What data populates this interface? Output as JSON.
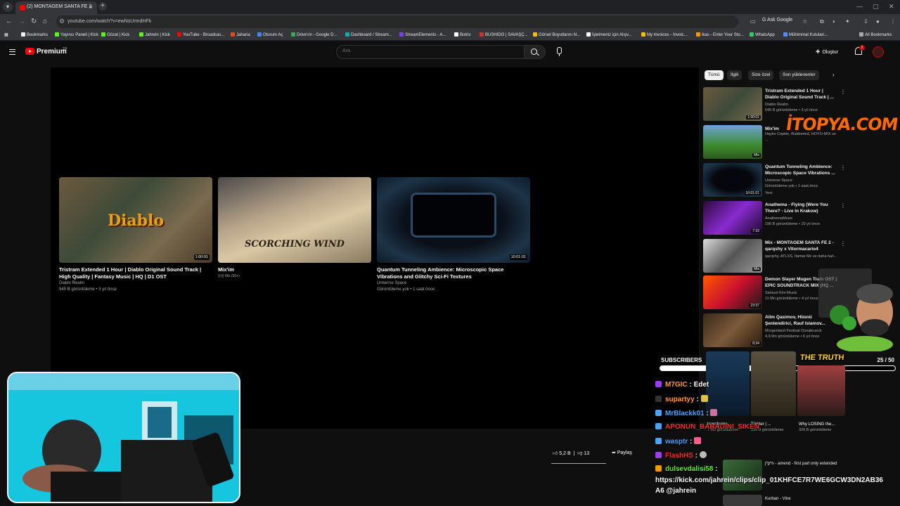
{
  "browser": {
    "tab_title": "(2) MONTAGEM SANTA FE 2",
    "url": "youtube.com/watch?v=ewNsUrmdHFk",
    "ask_google": "Ask Google",
    "all_bookmarks": "All Bookmarks",
    "bookmarks": [
      {
        "label": "Bookmarks",
        "color": "#f1f1f1"
      },
      {
        "label": "Yayıncı Paneli | Kick",
        "color": "#53fc18"
      },
      {
        "label": "Gözat | Kick",
        "color": "#53fc18"
      },
      {
        "label": "Jahrein | Kick",
        "color": "#53fc18"
      },
      {
        "label": "YouTube - Broadcas...",
        "color": "#ff0000"
      },
      {
        "label": "Jaharia",
        "color": "#e64a19"
      },
      {
        "label": "Oturum Aç",
        "color": "#4285f4"
      },
      {
        "label": "Drive'ım - Google D...",
        "color": "#34a853"
      },
      {
        "label": "Dashboard / Stream...",
        "color": "#00b2a9"
      },
      {
        "label": "StreamElements - A...",
        "color": "#7b3ff2"
      },
      {
        "label": "Botrix",
        "color": "#ffffff"
      },
      {
        "label": "BUSHIDO | SAVAŞÇ...",
        "color": "#d32f2f"
      },
      {
        "label": "Görsel Boyutlarını N...",
        "color": "#fbbc04"
      },
      {
        "label": "İşletmeniz için Alışv...",
        "color": "#ffffff"
      },
      {
        "label": "My Invoices - Invoic...",
        "color": "#fbbc04"
      },
      {
        "label": "ikas - Enter Your Sto...",
        "color": "#ff9800"
      },
      {
        "label": "WhatsApp",
        "color": "#25d366"
      },
      {
        "label": "Mühimmat Kutuları...",
        "color": "#4e8cff"
      }
    ]
  },
  "youtube": {
    "logo": "Premium",
    "logo_region": "TR",
    "search_placeholder": "Ara",
    "create_label": "Oluştur",
    "notification_count": "2",
    "accent": "#ff0000"
  },
  "endcards": [
    {
      "title": "Tristram Extended 1 Hour | Diablo Original Sound Track | High Quality | Fantasy Music | HQ | D1 OST",
      "channel": "Diablo Realm",
      "meta": "545 B görüntüleme • 3 yıl önce",
      "duration": "1:00:01",
      "overlay": "Diablo"
    },
    {
      "title": "Mix'im",
      "channel": "((•)) Mix (50+)",
      "meta": "",
      "duration": "",
      "overlay": "SCORCHING WIND"
    },
    {
      "title": "Quantum Tunneling Ambience: Microscopic Space Vibrations and Glitchy Sci-Fi Textures",
      "channel": "Universe Space",
      "meta": "Görüntüleme yok • 1 saat önce",
      "duration": "10:01:01",
      "overlay": ""
    }
  ],
  "actions": {
    "likes": "5,2 B",
    "dislikes": "13",
    "share": "Paylaş"
  },
  "sidebar": {
    "chips": [
      "Tümü",
      "İlgili",
      "Size özel",
      "Son yüklenenler"
    ],
    "items": [
      {
        "title": "Tristram Extended 1 Hour | Diablo Original Sound Track | ...",
        "channel": "Diablo Realm",
        "meta": "545 B görüntüleme • 3 yıl önce",
        "duration": "1:00:01"
      },
      {
        "title": "Mix'im",
        "channel": "Hayko Cepkin, Rubberied, HOYO-MIX ve ...",
        "meta": "",
        "duration": "Mix"
      },
      {
        "title": "Quantum Tunneling Ambience: Microscopic Space Vibrations ...",
        "channel": "Universe Space",
        "meta": "Görüntüleme yok • 1 saat önce",
        "badge": "Yeni",
        "duration": "10:01:01"
      },
      {
        "title": "Anathema - Flying (Were You There? - Live In Krakow)",
        "channel": "AnathemaMusic",
        "meta": "190 B görüntüleme • 10 yıl önce",
        "duration": "7:33"
      },
      {
        "title": "Mix - MONTAGEM SANTA FE 2 - qarqshy x Vitormacario4",
        "channel": "qarqshy, ATLXS, Itamar Mc ve daha fazl...",
        "meta": "",
        "duration": "Mix"
      },
      {
        "title": "Demon Slayer Mugen Train OST | EPIC SOUNDTRACK MIX (HQ ...",
        "channel": "Samuel Kim Music",
        "meta": "11 Mn görüntüleme • 4 yıl önce",
        "duration": "23:37"
      },
      {
        "title": "Alim Qasimov, Hüsnü Şenlendirici, Rauf Islamov...",
        "channel": "Morgenland Festival Osnabrueck",
        "meta": "4,9 Mn görüntüleme • 6 yıl önce",
        "duration": "8:34"
      }
    ]
  },
  "overlay": {
    "watermark": "İTOPYA.COM",
    "subscribers_label": "SUBSCRIBERS",
    "subscribers_count": "25 / 50",
    "subscribers_progress": 0.5,
    "truth_label": "THE TRUTH"
  },
  "chat": [
    {
      "user": "M7GIC",
      "text": "Edet",
      "color": "#ff9b3d",
      "icon": "#9b3dff"
    },
    {
      "user": "supartyy",
      "text": "",
      "color": "#ff9b3d",
      "icon": "#333333"
    },
    {
      "user": "MrBlackk01",
      "text": "",
      "color": "#4aa3ff",
      "icon": "#4aa3ff"
    },
    {
      "user": "APONUN_BABADINI_SIKEN",
      "text": "",
      "color": "#ff2a2a",
      "icon": "#4aa3ff"
    },
    {
      "user": "wasptr",
      "text": "",
      "color": "#4aa3ff",
      "icon": "#4aa3ff"
    },
    {
      "user": "FlashHS",
      "text": "",
      "color": "#ff2a2a",
      "icon": "#9b3dff"
    },
    {
      "user": "dulsevdalisi58",
      "text": "",
      "color": "#53fc18",
      "icon": "#ff9800"
    }
  ],
  "chat_link": "https://kick.com/jahrein/clips/clip_01KHFCE7R7WE6GCW3DN2AB36A6 @jahrein",
  "mini_videos": [
    {
      "title": "transforme...",
      "meta": "7 Mn görüntüleme"
    },
    {
      "title": "Türkler | ...",
      "meta": "396 B görüntüleme"
    },
    {
      "title": "Why LOSING the...",
      "meta": "326 B görüntüleme"
    }
  ],
  "bottom_recs": [
    {
      "title": "j*p*n - amend - first part only extended"
    },
    {
      "title": "Kurban - Vine"
    }
  ]
}
